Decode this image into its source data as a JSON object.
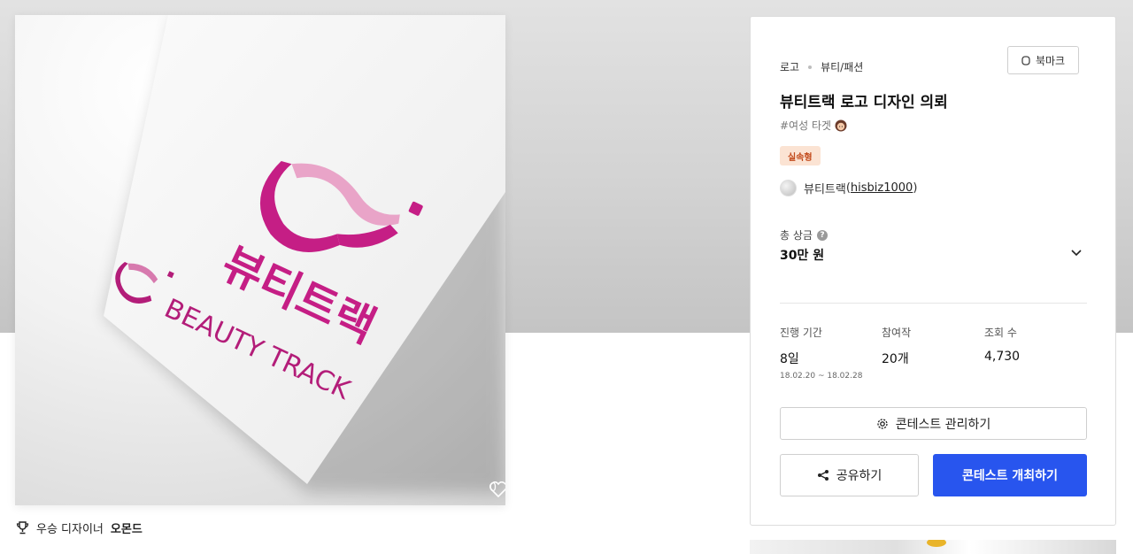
{
  "hero": {
    "logo_korean": "뷰티트랙",
    "logo_english": "BEAUTY TRACK",
    "likes": "0",
    "brand_color": "#c51e85"
  },
  "winner": {
    "label": "우승 디자이너",
    "name": "오몬드"
  },
  "card": {
    "breadcrumb": [
      "로고",
      "뷰티/패션"
    ],
    "bookmark_label": "북마크",
    "title": "뷰티트랙 로고 디자인 의뢰",
    "tag": "#여성 타겟",
    "badge": "실속형",
    "client_name": "뷰티트랙",
    "client_handle": "hisbiz1000",
    "prize_label": "총 상금",
    "prize_value": "30만 원",
    "stats": [
      {
        "label": "진행 기간",
        "value": "8일",
        "sub": "18.02.20 ~ 18.02.28"
      },
      {
        "label": "참여작",
        "value": "20개",
        "sub": ""
      },
      {
        "label": "조회 수",
        "value": "4,730",
        "sub": ""
      }
    ],
    "manage_label": "콘테스트 관리하기",
    "share_label": "공유하기",
    "host_label": "콘테스트 개최하기",
    "accent_color": "#2855ee"
  }
}
